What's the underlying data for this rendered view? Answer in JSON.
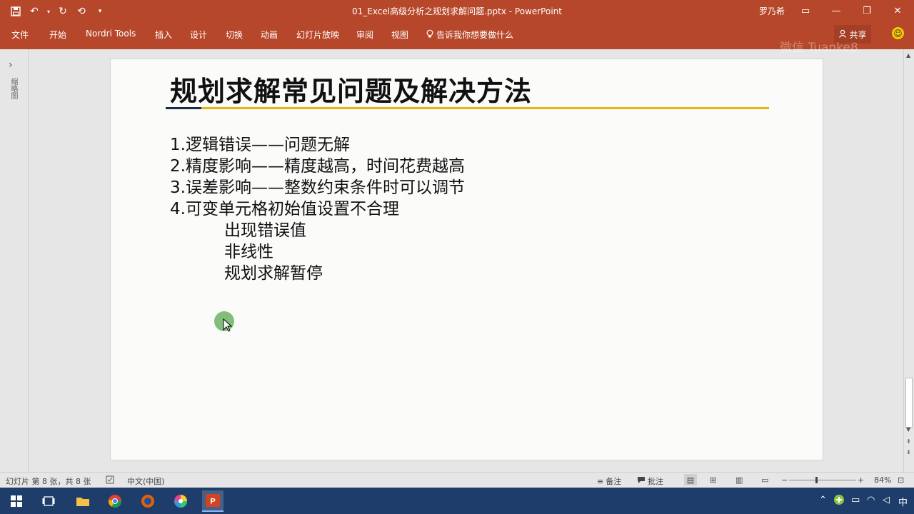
{
  "window": {
    "title": "01_Excel高级分析之规划求解问题.pptx  -  PowerPoint",
    "user": "罗乃希"
  },
  "ribbon": {
    "tabs": [
      "文件",
      "开始",
      "Nordri Tools",
      "插入",
      "设计",
      "切换",
      "动画",
      "幻灯片放映",
      "审阅",
      "视图"
    ],
    "tell_me": "告诉我你想要做什么",
    "share": "共享"
  },
  "watermark": "微信 Tuanke8",
  "slide": {
    "title": "规划求解常见问题及解决方法",
    "lines": [
      "1.逻辑错误——问题无解",
      "2.精度影响——精度越高，时间花费越高",
      "3.误差影响——整数约束条件时可以调节",
      "4.可变单元格初始值设置不合理"
    ],
    "sub_lines": [
      "出现错误值",
      "非线性",
      "规划求解暂停"
    ]
  },
  "leftpanel": {
    "label": "缩略图"
  },
  "status": {
    "slide_info": "幻灯片 第 8 张，共 8 张",
    "language": "中文(中国)",
    "notes": "备注",
    "comments": "批注",
    "zoom": "84%"
  },
  "tray": {
    "ime": "中"
  },
  "colors": {
    "accent": "#b7472a",
    "gold": "#e8b21b",
    "navy": "#1f2a44"
  }
}
